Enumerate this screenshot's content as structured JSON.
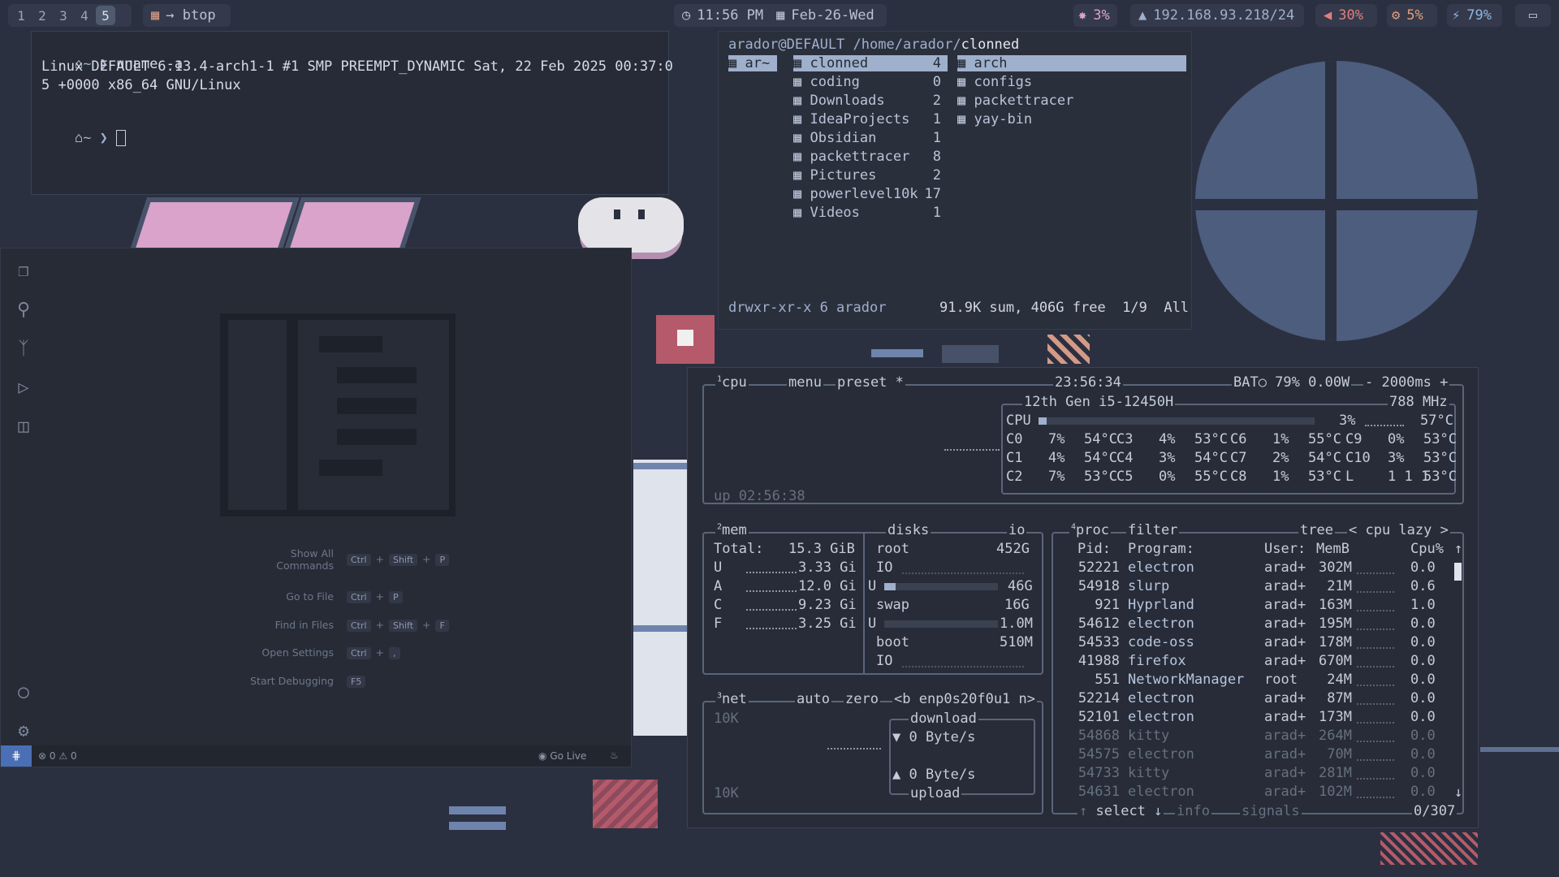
{
  "topbar": {
    "workspaces": [
      "1",
      "2",
      "3",
      "4",
      "5"
    ],
    "active_workspace": "5",
    "active_app": "→ btop",
    "clock": "11:56 PM",
    "date": "Feb-26-Wed",
    "gpu": "3%",
    "network": "192.168.93.218/24",
    "volume": "30%",
    "cpu": "5%",
    "battery": "79%"
  },
  "terminal": {
    "prompt1": "~ ❯",
    "command": "uname -a",
    "output_line1": "Linux DEFAULT 6.13.4-arch1-1 #1 SMP PREEMPT_DYNAMIC Sat, 22 Feb 2025 00:37:0",
    "output_line2": "5 +0000 x86_64 GNU/Linux",
    "prompt2": "~ ❯"
  },
  "lf": {
    "path_user": "arador@DEFAULT",
    "path_dir": "/home/arador/",
    "path_current": "clonned",
    "parent": "ar~",
    "items": [
      {
        "name": "clonned",
        "count": "4"
      },
      {
        "name": "coding",
        "count": "0"
      },
      {
        "name": "Downloads",
        "count": "2"
      },
      {
        "name": "IdeaProjects",
        "count": "1"
      },
      {
        "name": "Obsidian",
        "count": "1"
      },
      {
        "name": "packettracer",
        "count": "8"
      },
      {
        "name": "Pictures",
        "count": "2"
      },
      {
        "name": "powerlevel10k",
        "count": "17"
      },
      {
        "name": "Videos",
        "count": "1"
      }
    ],
    "preview": [
      "arch",
      "configs",
      "packettracer",
      "yay-bin"
    ],
    "status_perm": "drwxr-xr-x 6 arador",
    "status_info": "91.9K sum, 406G free  1/9  All"
  },
  "vscode": {
    "shortcuts": [
      {
        "label": "Show All\nCommands",
        "keys": [
          "Ctrl",
          "Shift",
          "P"
        ]
      },
      {
        "label": "Go to File",
        "keys": [
          "Ctrl",
          "P"
        ]
      },
      {
        "label": "Find in Files",
        "keys": [
          "Ctrl",
          "Shift",
          "F"
        ]
      },
      {
        "label": "Open Settings",
        "keys": [
          "Ctrl",
          ","
        ]
      },
      {
        "label": "Start Debugging",
        "keys": [
          "F5"
        ]
      }
    ],
    "status_errors": "0",
    "status_warnings": "0",
    "go_live": "Go Live"
  },
  "btop": {
    "cpu_tab": "cpu",
    "menu": "menu",
    "preset": "preset *",
    "time": "23:56:34",
    "battery": "BAT○ 79% 0.00W",
    "refresh": "- 2000ms +",
    "cpu_model": "12th Gen i5-12450H",
    "cpu_freq": "788 MHz",
    "cpu_total": {
      "label": "CPU",
      "pct": "3%",
      "temp": "57°C",
      "level": 0.03
    },
    "cores": [
      [
        "C0",
        "7%",
        "54°C"
      ],
      [
        "C3",
        "4%",
        "53°C"
      ],
      [
        "C6",
        "1%",
        "55°C"
      ],
      [
        "C9",
        "0%",
        "53°C"
      ],
      [
        "C1",
        "4%",
        "54°C"
      ],
      [
        "C4",
        "3%",
        "54°C"
      ],
      [
        "C7",
        "2%",
        "54°C"
      ],
      [
        "C10",
        "3%",
        "53°C"
      ],
      [
        "C2",
        "7%",
        "53°C"
      ],
      [
        "C5",
        "0%",
        "55°C"
      ],
      [
        "C8",
        "1%",
        "53°C"
      ],
      [
        "L",
        "1 1 1",
        "53°C"
      ]
    ],
    "uptime": "up 02:56:38",
    "mem": {
      "title": "mem",
      "total_label": "Total:",
      "total": "15.3 GiB",
      "rows": [
        [
          "U",
          "3.33 Gi"
        ],
        [
          "A",
          "12.0 Gi"
        ],
        [
          "C",
          "9.23 Gi"
        ],
        [
          "F",
          "3.25 Gi"
        ]
      ]
    },
    "disks": {
      "title": "disks",
      "io_tab": "io",
      "root_label": "root",
      "root_size": "452G",
      "io": "IO",
      "root_used_label": "U",
      "root_used": "46G",
      "root_level": 0.1,
      "swap_label": "swap",
      "swap_size": "16G",
      "swap_used_label": "U",
      "swap_used": "1.0M",
      "swap_level": 0.0,
      "boot_label": "boot",
      "boot_size": "510M",
      "boot_io": "IO"
    },
    "net": {
      "title": "net",
      "auto": "auto",
      "zero": "zero",
      "iface": "<b enp0s20f0u1 n>",
      "scale_top": "10K",
      "scale_bottom": "10K",
      "download_label": "download",
      "download": "▼ 0 Byte/s",
      "upload": "▲ 0 Byte/s",
      "upload_label": "upload"
    },
    "proc": {
      "title": "proc",
      "filter": "filter",
      "tree": "tree",
      "sort": "< cpu lazy >",
      "headers": [
        "Pid:",
        "Program:",
        "User:",
        "MemB",
        "Cpu%"
      ],
      "rows": [
        [
          "52221",
          "electron",
          "arad+",
          "302M",
          "0.0"
        ],
        [
          "54918",
          "slurp",
          "arad+",
          "21M",
          "0.6"
        ],
        [
          "921",
          "Hyprland",
          "arad+",
          "163M",
          "1.0"
        ],
        [
          "54612",
          "electron",
          "arad+",
          "195M",
          "0.0"
        ],
        [
          "54533",
          "code-oss",
          "arad+",
          "178M",
          "0.0"
        ],
        [
          "41988",
          "firefox",
          "arad+",
          "670M",
          "0.0"
        ],
        [
          "551",
          "NetworkManager",
          "root",
          "24M",
          "0.0"
        ],
        [
          "52214",
          "electron",
          "arad+",
          "87M",
          "0.0"
        ],
        [
          "52101",
          "electron",
          "arad+",
          "173M",
          "0.0"
        ],
        [
          "54868",
          "kitty",
          "arad+",
          "264M",
          "0.0"
        ],
        [
          "54575",
          "electron",
          "arad+",
          "70M",
          "0.0"
        ],
        [
          "54733",
          "kitty",
          "arad+",
          "281M",
          "0.0"
        ],
        [
          "54631",
          "electron",
          "arad+",
          "102M",
          "0.0"
        ]
      ],
      "select": "select",
      "info": "info",
      "signals": "signals",
      "count": "0/307"
    }
  },
  "colors": {
    "bg": "#2b3040",
    "accent": "#9fb0cc",
    "pink": "#d9a3cb"
  }
}
